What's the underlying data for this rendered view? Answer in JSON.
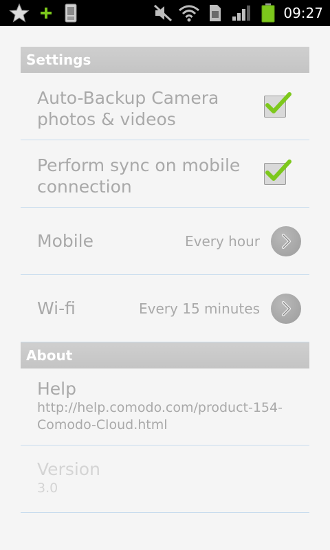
{
  "status_bar": {
    "time": "09:27",
    "icons": [
      "star-icon",
      "plus-icon",
      "phone-icon",
      "muted-volume-icon",
      "wifi-icon",
      "sim-icon",
      "signal-icon",
      "battery-icon"
    ]
  },
  "settings": {
    "header": "Settings",
    "auto_backup": {
      "line1": "Auto-Backup Camera",
      "line2": "photos & videos",
      "checked": true
    },
    "sync_mobile": {
      "line1": "Perform sync on mobile",
      "line2": "connection",
      "checked": true
    },
    "mobile": {
      "label": "Mobile",
      "value": "Every hour"
    },
    "wifi": {
      "label": "Wi-fi",
      "value": "Every 15 minutes"
    }
  },
  "about": {
    "header": "About",
    "help": {
      "label": "Help",
      "line1": "http://help.comodo.com/product-154-",
      "line2": "Comodo-Cloud.html"
    },
    "version": {
      "label": "Version",
      "value": "3.0"
    }
  },
  "colors": {
    "accent_check": "#7dc81c",
    "divider": "#c8dcee",
    "header_bg": "#c8c8c8"
  }
}
